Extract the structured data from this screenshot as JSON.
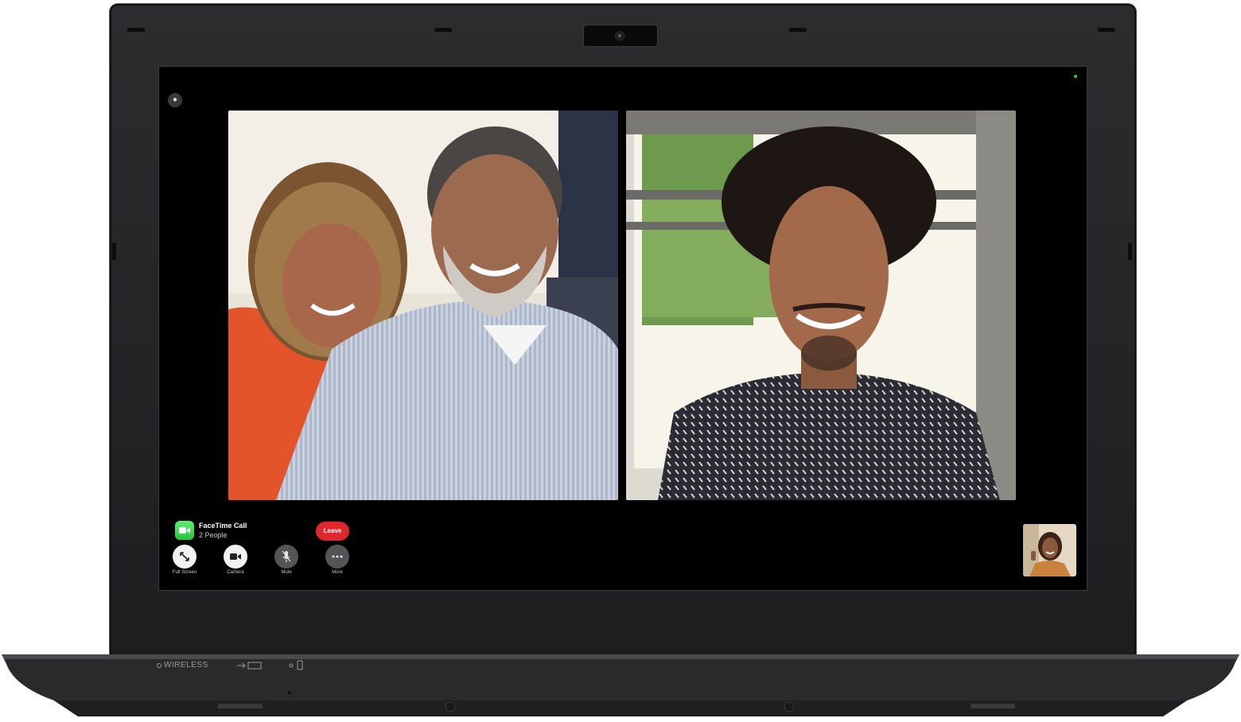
{
  "call": {
    "title": "FaceTime Call",
    "participants": "2 People",
    "leave_label": "Leave"
  },
  "controls": [
    {
      "label": "Full Screen",
      "icon": "fullscreen-icon"
    },
    {
      "label": "Camera",
      "icon": "camera-icon"
    },
    {
      "label": "Mute",
      "icon": "microphone-icon"
    },
    {
      "label": "More",
      "icon": "ellipsis-icon"
    }
  ],
  "laptop": {
    "wireless_label": "WIRELESS"
  },
  "colors": {
    "leave": "#e0272d",
    "facetime_green": "#34c759",
    "screen_bg": "#000000"
  }
}
